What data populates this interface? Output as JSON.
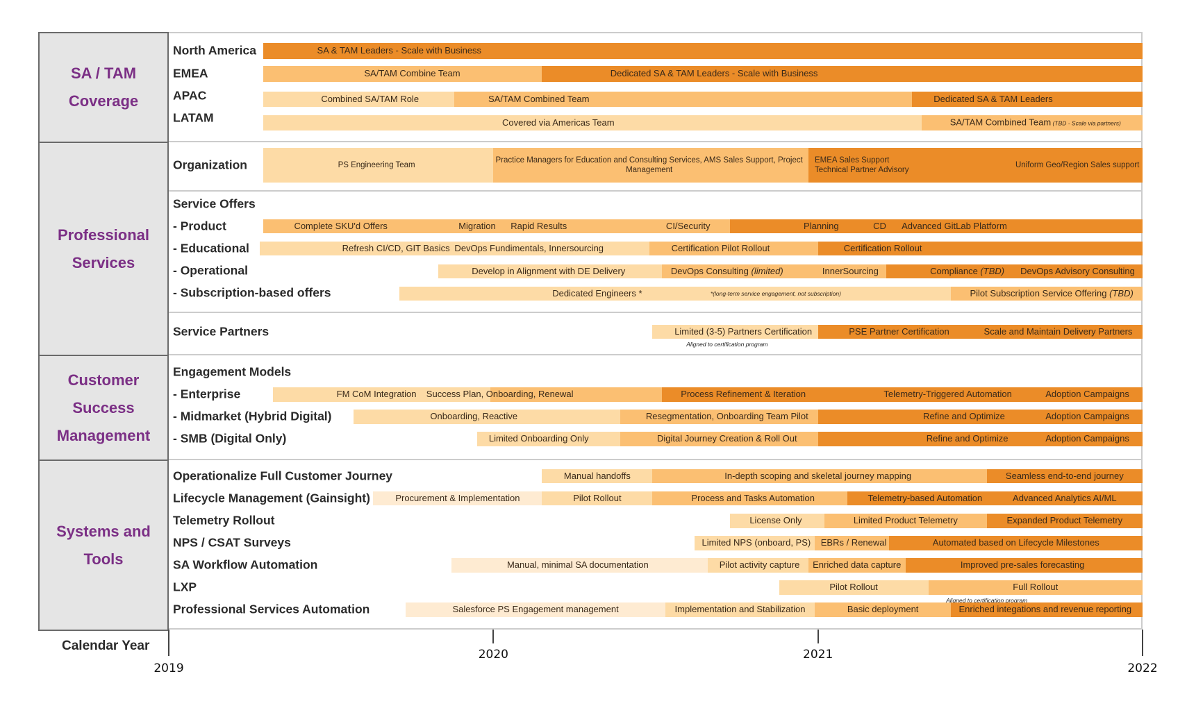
{
  "colors": {
    "dark": "#eb8c28",
    "medium": "#fbbf72",
    "light": "#fddba6",
    "pale": "#feebd2",
    "category_text": "#7b2f85"
  },
  "chart_data": {
    "type": "gantt",
    "title": "",
    "xlabel": "Calendar Year",
    "x_range": [
      2019,
      2022
    ],
    "x_ticks": [
      "2019",
      "2020",
      "2021",
      "2022"
    ],
    "grid": false,
    "categories": [
      {
        "name": "SA / TAM\nCoverage",
        "rows": [
          "North America",
          "EMEA",
          "APAC",
          "LATAM"
        ]
      },
      {
        "name": "Professional\nServices",
        "rows": [
          "Organization",
          "Service Offers",
          "- Product",
          "- Educational",
          "- Operational",
          "- Subscription-based offers",
          "Service Partners"
        ]
      },
      {
        "name": "Customer\nSuccess\nManagement",
        "rows": [
          "Engagement Models",
          "- Enterprise",
          "- Midmarket (Hybrid Digital)",
          "- SMB (Digital Only)"
        ]
      },
      {
        "name": "Systems and\nTools",
        "rows": [
          "Operationalize Full Customer Journey",
          "Lifecycle Management (Gainsight)",
          "Telemetry Rollout",
          "NPS / CSAT Surveys",
          "SA Workflow Automation",
          "LXP",
          "Professional Services Automation"
        ]
      }
    ],
    "rows": [
      {
        "label": "North America",
        "segments": [
          {
            "start": 2019.29,
            "end": 2022.0,
            "level": "dark"
          }
        ],
        "labels": [
          {
            "text": "SA & TAM Leaders - Scale with Business",
            "at": 2019.71
          }
        ]
      },
      {
        "label": "EMEA",
        "segments": [
          {
            "start": 2019.29,
            "end": 2020.15,
            "level": "medium"
          },
          {
            "start": 2020.15,
            "end": 2022.0,
            "level": "dark"
          }
        ],
        "labels": [
          {
            "text": "SA/TAM Combine Team",
            "at": 2019.75
          },
          {
            "text": "Dedicated SA & TAM Leaders - Scale with Business",
            "at": 2020.68
          }
        ]
      },
      {
        "label": "APAC",
        "segments": [
          {
            "start": 2019.29,
            "end": 2019.88,
            "level": "light"
          },
          {
            "start": 2019.88,
            "end": 2021.29,
            "level": "medium"
          },
          {
            "start": 2021.29,
            "end": 2022.0,
            "level": "dark"
          }
        ],
        "labels": [
          {
            "text": "Combined SA/TAM Role",
            "at": 2019.62
          },
          {
            "text": "SA/TAM Combined Team",
            "at": 2020.14
          },
          {
            "text": "Dedicated SA & TAM Leaders",
            "at": 2021.54
          }
        ]
      },
      {
        "label": "LATAM",
        "segments": [
          {
            "start": 2019.29,
            "end": 2021.32,
            "level": "light"
          },
          {
            "start": 2021.32,
            "end": 2022.0,
            "level": "medium"
          }
        ],
        "labels": [
          {
            "text": "Covered via Americas Team",
            "at": 2020.2
          },
          {
            "text": "SA/TAM Combined Team",
            "note": "(TBD - Scale via partners)",
            "at": 2021.67
          }
        ]
      },
      {
        "label": "Organization",
        "segments": [
          {
            "start": 2019.29,
            "end": 2020.0,
            "level": "light"
          },
          {
            "start": 2020.0,
            "end": 2020.97,
            "level": "medium"
          },
          {
            "start": 2020.97,
            "end": 2022.0,
            "level": "dark"
          }
        ],
        "labels": [
          {
            "text": "PS Engineering Team",
            "at": 2019.64
          },
          {
            "text": "Practice Managers for Education and Consulting Services, AMS Sales Support, Project Management",
            "at": 2020.48,
            "wrap": true
          },
          {
            "text": "EMEA Sales Support\nTechnical Partner Advisory",
            "at": 2020.99,
            "align": "left"
          },
          {
            "text": "Uniform Geo/Region Sales support",
            "at": 2021.99,
            "align": "right"
          }
        ]
      },
      {
        "label": "Service Offers",
        "segments": [],
        "labels": []
      },
      {
        "label": "- Product",
        "segments": [
          {
            "start": 2019.29,
            "end": 2020.73,
            "level": "medium"
          },
          {
            "start": 2020.73,
            "end": 2022.0,
            "level": "dark"
          }
        ],
        "labels": [
          {
            "text": "Complete SKU'd Offers",
            "at": 2019.53
          },
          {
            "text": "Migration",
            "at": 2019.95
          },
          {
            "text": "Rapid Results",
            "at": 2020.14
          },
          {
            "text": "CI/Security",
            "at": 2020.6
          },
          {
            "text": "Planning",
            "at": 2021.01
          },
          {
            "text": "CD",
            "at": 2021.19
          },
          {
            "text": "Advanced GitLab Platform",
            "at": 2021.42
          }
        ]
      },
      {
        "label": "- Educational",
        "segments": [
          {
            "start": 2019.28,
            "end": 2020.48,
            "level": "light"
          },
          {
            "start": 2020.48,
            "end": 2021.0,
            "level": "medium"
          },
          {
            "start": 2021.0,
            "end": 2022.0,
            "level": "dark"
          }
        ],
        "labels": [
          {
            "text": "Refresh CI/CD, GIT Basics",
            "at": 2019.7
          },
          {
            "text": "DevOps Fundimentals, Innersourcing",
            "at": 2020.11
          },
          {
            "text": "Certification Pilot Rollout",
            "at": 2020.7
          },
          {
            "text": "Certification Rollout",
            "at": 2021.2
          }
        ]
      },
      {
        "label": "- Operational",
        "segments": [
          {
            "start": 2019.83,
            "end": 2020.52,
            "level": "light"
          },
          {
            "start": 2020.52,
            "end": 2021.21,
            "level": "medium"
          },
          {
            "start": 2021.21,
            "end": 2022.0,
            "level": "dark"
          }
        ],
        "labels": [
          {
            "text": "Develop in Alignment with DE Delivery",
            "at": 2020.17
          },
          {
            "text": "DevOps Consulting",
            "note": "(limited)",
            "at": 2020.72
          },
          {
            "text": "InnerSourcing",
            "at": 2021.1
          },
          {
            "text": "Compliance",
            "note": "(TBD)",
            "at": 2021.46
          },
          {
            "text": "DevOps Advisory Consulting",
            "at": 2021.8
          }
        ]
      },
      {
        "label": "- Subscription-based offers",
        "segments": [
          {
            "start": 2019.71,
            "end": 2021.41,
            "level": "light"
          },
          {
            "start": 2021.41,
            "end": 2022.0,
            "level": "medium"
          }
        ],
        "labels": [
          {
            "text": "Dedicated Engineers *",
            "at": 2020.32
          },
          {
            "text": "*(long-term service engagement, not subscription)",
            "at": 2020.87,
            "small_italic": true
          },
          {
            "text": "Pilot Subscription Service Offering",
            "note": "(TBD)",
            "at": 2021.72
          }
        ]
      },
      {
        "label": "Service Partners",
        "segments": [
          {
            "start": 2020.49,
            "end": 2021.0,
            "level": "light"
          },
          {
            "start": 2021.0,
            "end": 2022.0,
            "level": "dark"
          }
        ],
        "labels": [
          {
            "text": "Limited (3-5) Partners Certification",
            "at": 2020.77
          },
          {
            "text": "PSE Partner Certification",
            "at": 2021.25
          },
          {
            "text": "Scale and Maintain Delivery Partners",
            "at": 2021.74
          }
        ],
        "annotation": {
          "text": "Aligned to certification program",
          "at": 2020.72
        }
      },
      {
        "label": "Engagement Models",
        "segments": [],
        "labels": []
      },
      {
        "label": "- Enterprise",
        "segments": [
          {
            "start": 2019.32,
            "end": 2019.99,
            "level": "light"
          },
          {
            "start": 2019.99,
            "end": 2020.52,
            "level": "medium"
          },
          {
            "start": 2020.52,
            "end": 2022.0,
            "level": "dark"
          }
        ],
        "labels": [
          {
            "text": "FM CoM Integration",
            "at": 2019.64
          },
          {
            "text": "Success Plan, Onboarding, Renewal",
            "at": 2020.02
          },
          {
            "text": "Process Refinement & Iteration",
            "at": 2020.77
          },
          {
            "text": "Telemetry-Triggered Automation",
            "at": 2021.4
          },
          {
            "text": "Adoption Campaigns",
            "at": 2021.83
          }
        ]
      },
      {
        "label": "- Midmarket (Hybrid Digital)",
        "segments": [
          {
            "start": 2019.57,
            "end": 2020.39,
            "level": "light"
          },
          {
            "start": 2020.39,
            "end": 2021.0,
            "level": "medium"
          },
          {
            "start": 2021.0,
            "end": 2022.0,
            "level": "dark"
          }
        ],
        "labels": [
          {
            "text": "Onboarding, Reactive",
            "at": 2019.94
          },
          {
            "text": "Resegmentation, Onboarding Team Pilot",
            "at": 2020.72
          },
          {
            "text": "Refine and Optimize",
            "at": 2021.45
          },
          {
            "text": "Adoption Campaigns",
            "at": 2021.83
          }
        ]
      },
      {
        "label": "- SMB (Digital Only)",
        "segments": [
          {
            "start": 2019.95,
            "end": 2020.39,
            "level": "light"
          },
          {
            "start": 2020.39,
            "end": 2021.0,
            "level": "medium"
          },
          {
            "start": 2021.0,
            "end": 2022.0,
            "level": "dark"
          }
        ],
        "labels": [
          {
            "text": "Limited Onboarding Only",
            "at": 2020.14
          },
          {
            "text": "Digital Journey Creation & Roll Out",
            "at": 2020.72
          },
          {
            "text": "Refine and Optimize",
            "at": 2021.46
          },
          {
            "text": "Adoption Campaigns",
            "at": 2021.83
          }
        ]
      },
      {
        "label": "Operationalize Full Customer Journey",
        "segments": [
          {
            "start": 2020.15,
            "end": 2020.49,
            "level": "light"
          },
          {
            "start": 2020.49,
            "end": 2021.52,
            "level": "medium"
          },
          {
            "start": 2021.52,
            "end": 2022.0,
            "level": "dark"
          }
        ],
        "labels": [
          {
            "text": "Manual handoffs",
            "at": 2020.32
          },
          {
            "text": "In-depth scoping and skeletal journey mapping",
            "at": 2021.0
          },
          {
            "text": "Seamless end-to-end journey",
            "at": 2021.76
          }
        ]
      },
      {
        "label": "Lifecycle Management (Gainsight)",
        "segments": [
          {
            "start": 2019.63,
            "end": 2020.15,
            "level": "pale"
          },
          {
            "start": 2020.15,
            "end": 2020.49,
            "level": "light"
          },
          {
            "start": 2020.49,
            "end": 2021.09,
            "level": "medium"
          },
          {
            "start": 2021.09,
            "end": 2022.0,
            "level": "dark"
          }
        ],
        "labels": [
          {
            "text": "Procurement & Implementation",
            "at": 2019.89
          },
          {
            "text": "Pilot Rollout",
            "at": 2020.32
          },
          {
            "text": "Process and Tasks Automation",
            "at": 2020.8
          },
          {
            "text": "Telemetry-based Automation",
            "at": 2021.33
          },
          {
            "text": "Advanced Analytics  AI/ML",
            "at": 2021.76
          }
        ]
      },
      {
        "label": "Telemetry Rollout",
        "segments": [
          {
            "start": 2020.73,
            "end": 2021.02,
            "level": "light"
          },
          {
            "start": 2021.02,
            "end": 2021.52,
            "level": "medium"
          },
          {
            "start": 2021.52,
            "end": 2022.0,
            "level": "dark"
          }
        ],
        "labels": [
          {
            "text": "License Only",
            "at": 2020.87
          },
          {
            "text": "Limited Product Telemetry",
            "at": 2021.27
          },
          {
            "text": "Expanded Product Telemetry",
            "at": 2021.76
          }
        ]
      },
      {
        "label": "NPS / CSAT Surveys",
        "segments": [
          {
            "start": 2020.62,
            "end": 2020.99,
            "level": "light"
          },
          {
            "start": 2020.99,
            "end": 2021.22,
            "level": "medium"
          },
          {
            "start": 2021.22,
            "end": 2022.0,
            "level": "dark"
          }
        ],
        "labels": [
          {
            "text": "Limited NPS (onboard, PS)",
            "at": 2020.81
          },
          {
            "text": "EBRs / Renewal",
            "at": 2021.11
          },
          {
            "text": "Automated based on Lifecycle Milestones",
            "at": 2021.61
          }
        ]
      },
      {
        "label": "SA Workflow Automation",
        "segments": [
          {
            "start": 2019.87,
            "end": 2020.66,
            "level": "pale"
          },
          {
            "start": 2020.66,
            "end": 2020.97,
            "level": "light"
          },
          {
            "start": 2020.97,
            "end": 2021.27,
            "level": "medium"
          },
          {
            "start": 2021.27,
            "end": 2022.0,
            "level": "dark"
          }
        ],
        "labels": [
          {
            "text": "Manual, minimal SA documentation",
            "at": 2020.26
          },
          {
            "text": "Pilot activity capture",
            "at": 2020.82
          },
          {
            "text": "Enriched data capture",
            "at": 2021.12
          },
          {
            "text": "Improved pre-sales forecasting",
            "at": 2021.63
          }
        ]
      },
      {
        "label": "LXP",
        "segments": [
          {
            "start": 2020.88,
            "end": 2021.34,
            "level": "light"
          },
          {
            "start": 2021.34,
            "end": 2022.0,
            "level": "medium"
          }
        ],
        "labels": [
          {
            "text": "Pilot Rollout",
            "at": 2021.11
          },
          {
            "text": "Full Rollout",
            "at": 2021.67
          }
        ],
        "annotation": {
          "text": "Aligned to certification program",
          "at": 2021.52
        }
      },
      {
        "label": "Professional Services Automation",
        "segments": [
          {
            "start": 2019.73,
            "end": 2020.53,
            "level": "pale"
          },
          {
            "start": 2020.53,
            "end": 2020.99,
            "level": "light"
          },
          {
            "start": 2020.99,
            "end": 2021.41,
            "level": "medium"
          },
          {
            "start": 2021.41,
            "end": 2022.0,
            "level": "dark"
          }
        ],
        "labels": [
          {
            "text": "Salesforce PS Engagement management",
            "at": 2020.13
          },
          {
            "text": "Implementation and Stabilization",
            "at": 2020.76
          },
          {
            "text": "Basic deployment",
            "at": 2021.2
          },
          {
            "text": "Enriched integations and revenue reporting",
            "at": 2021.7
          }
        ]
      }
    ]
  }
}
